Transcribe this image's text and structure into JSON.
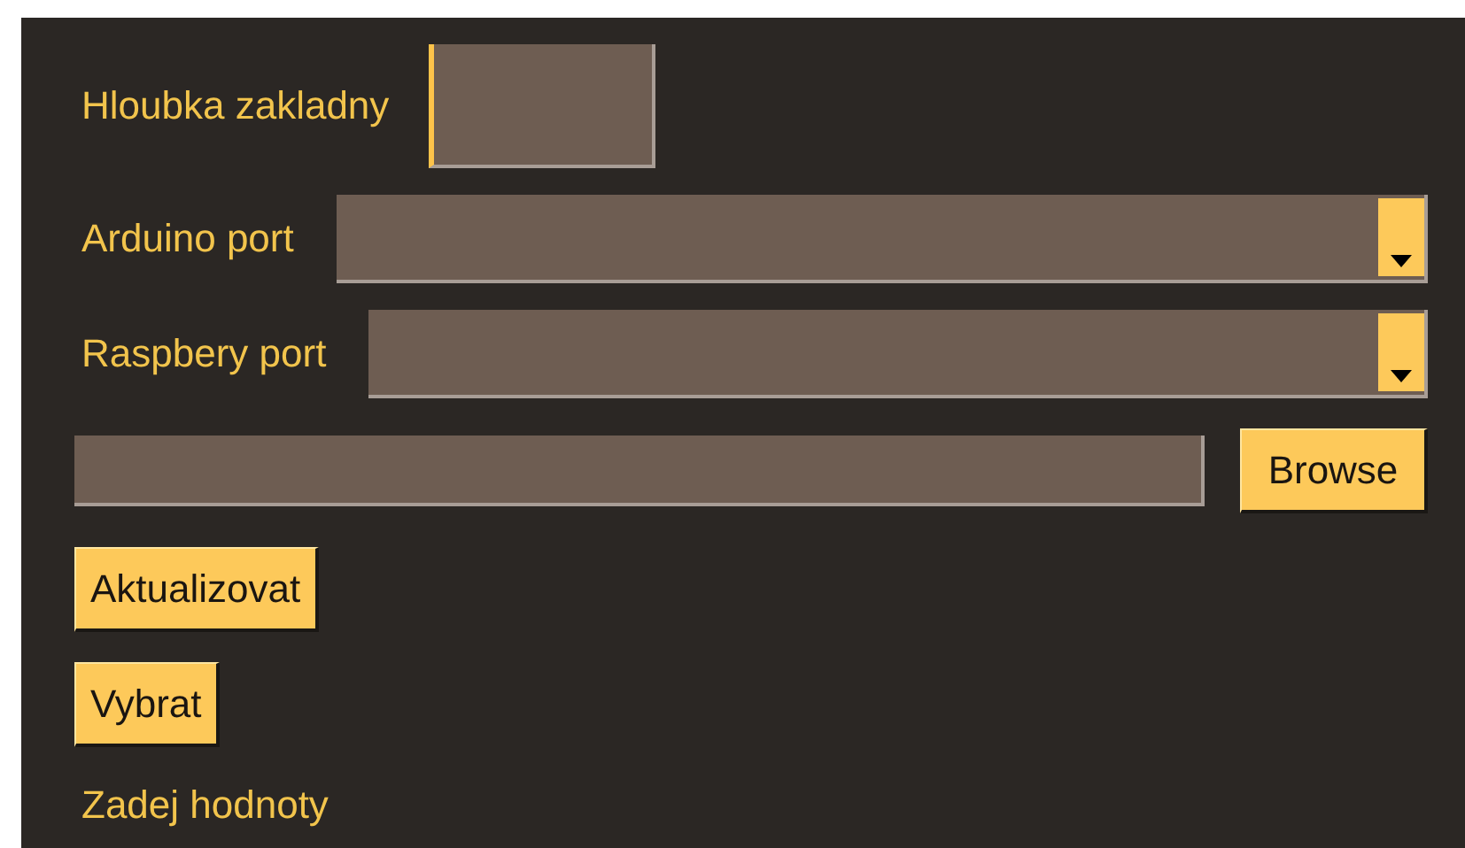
{
  "depth_field": {
    "label": "Hloubka zakladny",
    "focused": true
  },
  "arduino_port": {
    "label": "Arduino port"
  },
  "raspberry_port": {
    "label": "Raspbery port"
  },
  "path_field": {
    "button": "Browse"
  },
  "buttons": [
    "Aktualizovat",
    "Vybrat"
  ],
  "status": "Zadej hodnoty"
}
